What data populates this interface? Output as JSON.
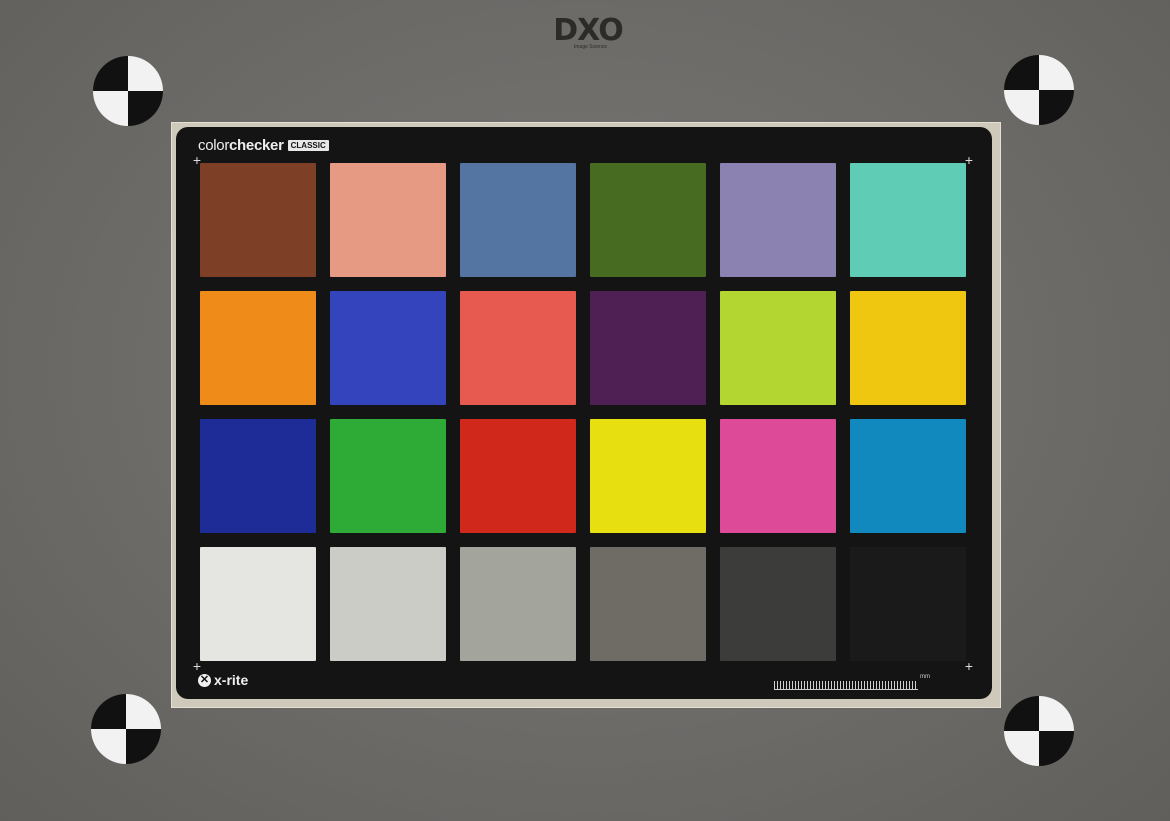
{
  "logo": {
    "text": "DXO",
    "subtitle": "Image Science"
  },
  "card": {
    "brand_light": "color",
    "brand_bold": "checker",
    "brand_tag": "CLASSIC",
    "maker": "x-rite",
    "ruler_unit": "mm"
  },
  "patches": [
    "#7d3f25",
    "#e69a84",
    "#5475a1",
    "#476b21",
    "#8c82b2",
    "#5fcdb5",
    "#ef8b18",
    "#3444bc",
    "#e75a4f",
    "#4f2054",
    "#b3d730",
    "#efc710",
    "#1d2c97",
    "#2dab36",
    "#d0291c",
    "#e8df10",
    "#dd4a97",
    "#1189be",
    "#e5e6e2",
    "#cbccc5",
    "#a3a49b",
    "#6e6c64",
    "#3c3c3a",
    "#1a1a1a"
  ],
  "colors": {
    "background": "#6f6d6a",
    "card": "#141414",
    "mount": "#cfc9bb"
  }
}
